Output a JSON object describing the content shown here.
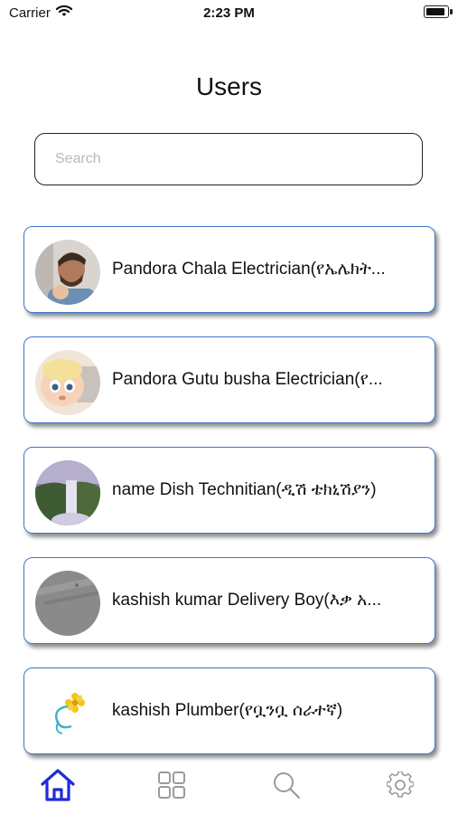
{
  "status_bar": {
    "carrier": "Carrier",
    "time": "2:23 PM"
  },
  "page": {
    "title": "Users"
  },
  "search": {
    "placeholder": "Search",
    "value": ""
  },
  "users": [
    {
      "name": "Pandora Chala Electrician(የኤሌክት...",
      "avatar": "man-avatar-photo"
    },
    {
      "name": "Pandora Gutu busha Electrician(የ...",
      "avatar": "cartoon-baby-avatar"
    },
    {
      "name": "name Dish Technitian(ዲሽ ቴክኒሽያን)",
      "avatar": "waterfall-avatar"
    },
    {
      "name": "kashish kumar Delivery Boy(እቃ አ...",
      "avatar": "gray-texture-avatar"
    },
    {
      "name": "kashish Plumber(የቧንቧ ሰራተኛ)",
      "avatar": "flower-logo-avatar"
    }
  ],
  "tab_bar": {
    "tabs": [
      {
        "id": "home",
        "icon": "home-icon",
        "active": true
      },
      {
        "id": "categories",
        "icon": "grid-icon",
        "active": false
      },
      {
        "id": "search",
        "icon": "search-icon",
        "active": false
      },
      {
        "id": "settings",
        "icon": "gear-icon",
        "active": false
      }
    ]
  },
  "colors": {
    "accent": "#1f2bd6",
    "card_border": "#3c78c6",
    "inactive_icon": "#9a9a9a"
  }
}
